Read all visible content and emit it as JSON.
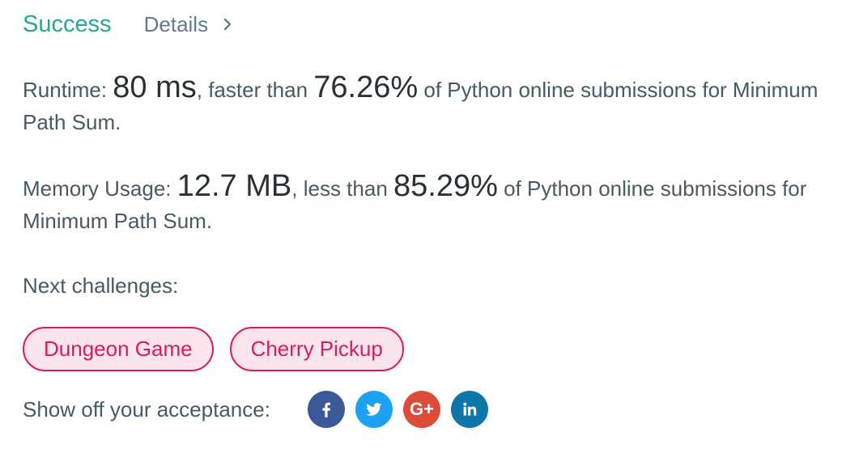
{
  "header": {
    "status": "Success",
    "details_label": "Details"
  },
  "runtime": {
    "label": "Runtime: ",
    "value": "80 ms",
    "mid": ", faster than ",
    "percent": "76.26%",
    "tail": " of Python online submissions for Minimum Path Sum."
  },
  "memory": {
    "label": "Memory Usage: ",
    "value": "12.7 MB",
    "mid": ", less than ",
    "percent": "85.29%",
    "tail": " of Python online submissions for Minimum Path Sum."
  },
  "next": {
    "label": "Next challenges:",
    "items": [
      {
        "label": "Dungeon Game"
      },
      {
        "label": "Cherry Pickup"
      }
    ]
  },
  "share": {
    "label": "Show off your acceptance:",
    "icons": [
      {
        "name": "facebook-icon",
        "color": "#3b5998"
      },
      {
        "name": "twitter-icon",
        "color": "#1da1f2"
      },
      {
        "name": "google-plus-icon",
        "color": "#dd4b39",
        "text": "G+"
      },
      {
        "name": "linkedin-icon",
        "color": "#0e76a8"
      }
    ]
  },
  "colors": {
    "success": "#26a69a",
    "challenge": "#d81b60",
    "challenge_bg": "#fce4ec"
  }
}
